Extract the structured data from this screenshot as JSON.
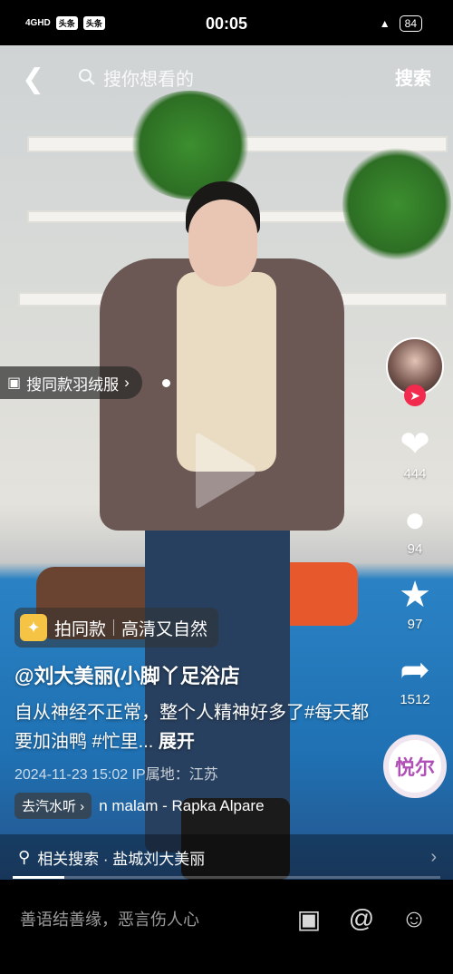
{
  "status_bar": {
    "network": "4GHD",
    "chips": [
      "头条",
      "头条"
    ],
    "time": "00:05",
    "battery": "84"
  },
  "topbar": {
    "search_placeholder": "搜你想看的",
    "search_button": "搜索"
  },
  "overlay": {
    "same_item_label": "搜同款羽绒服"
  },
  "rail": {
    "likes": "444",
    "comments": "94",
    "favorites": "97",
    "shares": "1512",
    "music_disc_text": "悦尔"
  },
  "info": {
    "tag_primary": "拍同款",
    "tag_secondary": "高清又自然",
    "author": "@刘大美丽(小脚丫足浴店",
    "description": "自从神经不正常，整个人精神好多了#每天都要加油鸭 #忙里...",
    "expand_label": "展开",
    "datetime": "2024-11-23 15:02",
    "ip_location": "IP属地：江苏",
    "qishui_label": "去汽水听",
    "music_title": "n malam - Rapka Alpare"
  },
  "related_search": {
    "label": "相关搜索 · 盐城刘大美丽"
  },
  "playback": {
    "progress_fraction": 0.12
  },
  "comment_bar": {
    "placeholder": "善语结善缘，恶言伤人心"
  }
}
